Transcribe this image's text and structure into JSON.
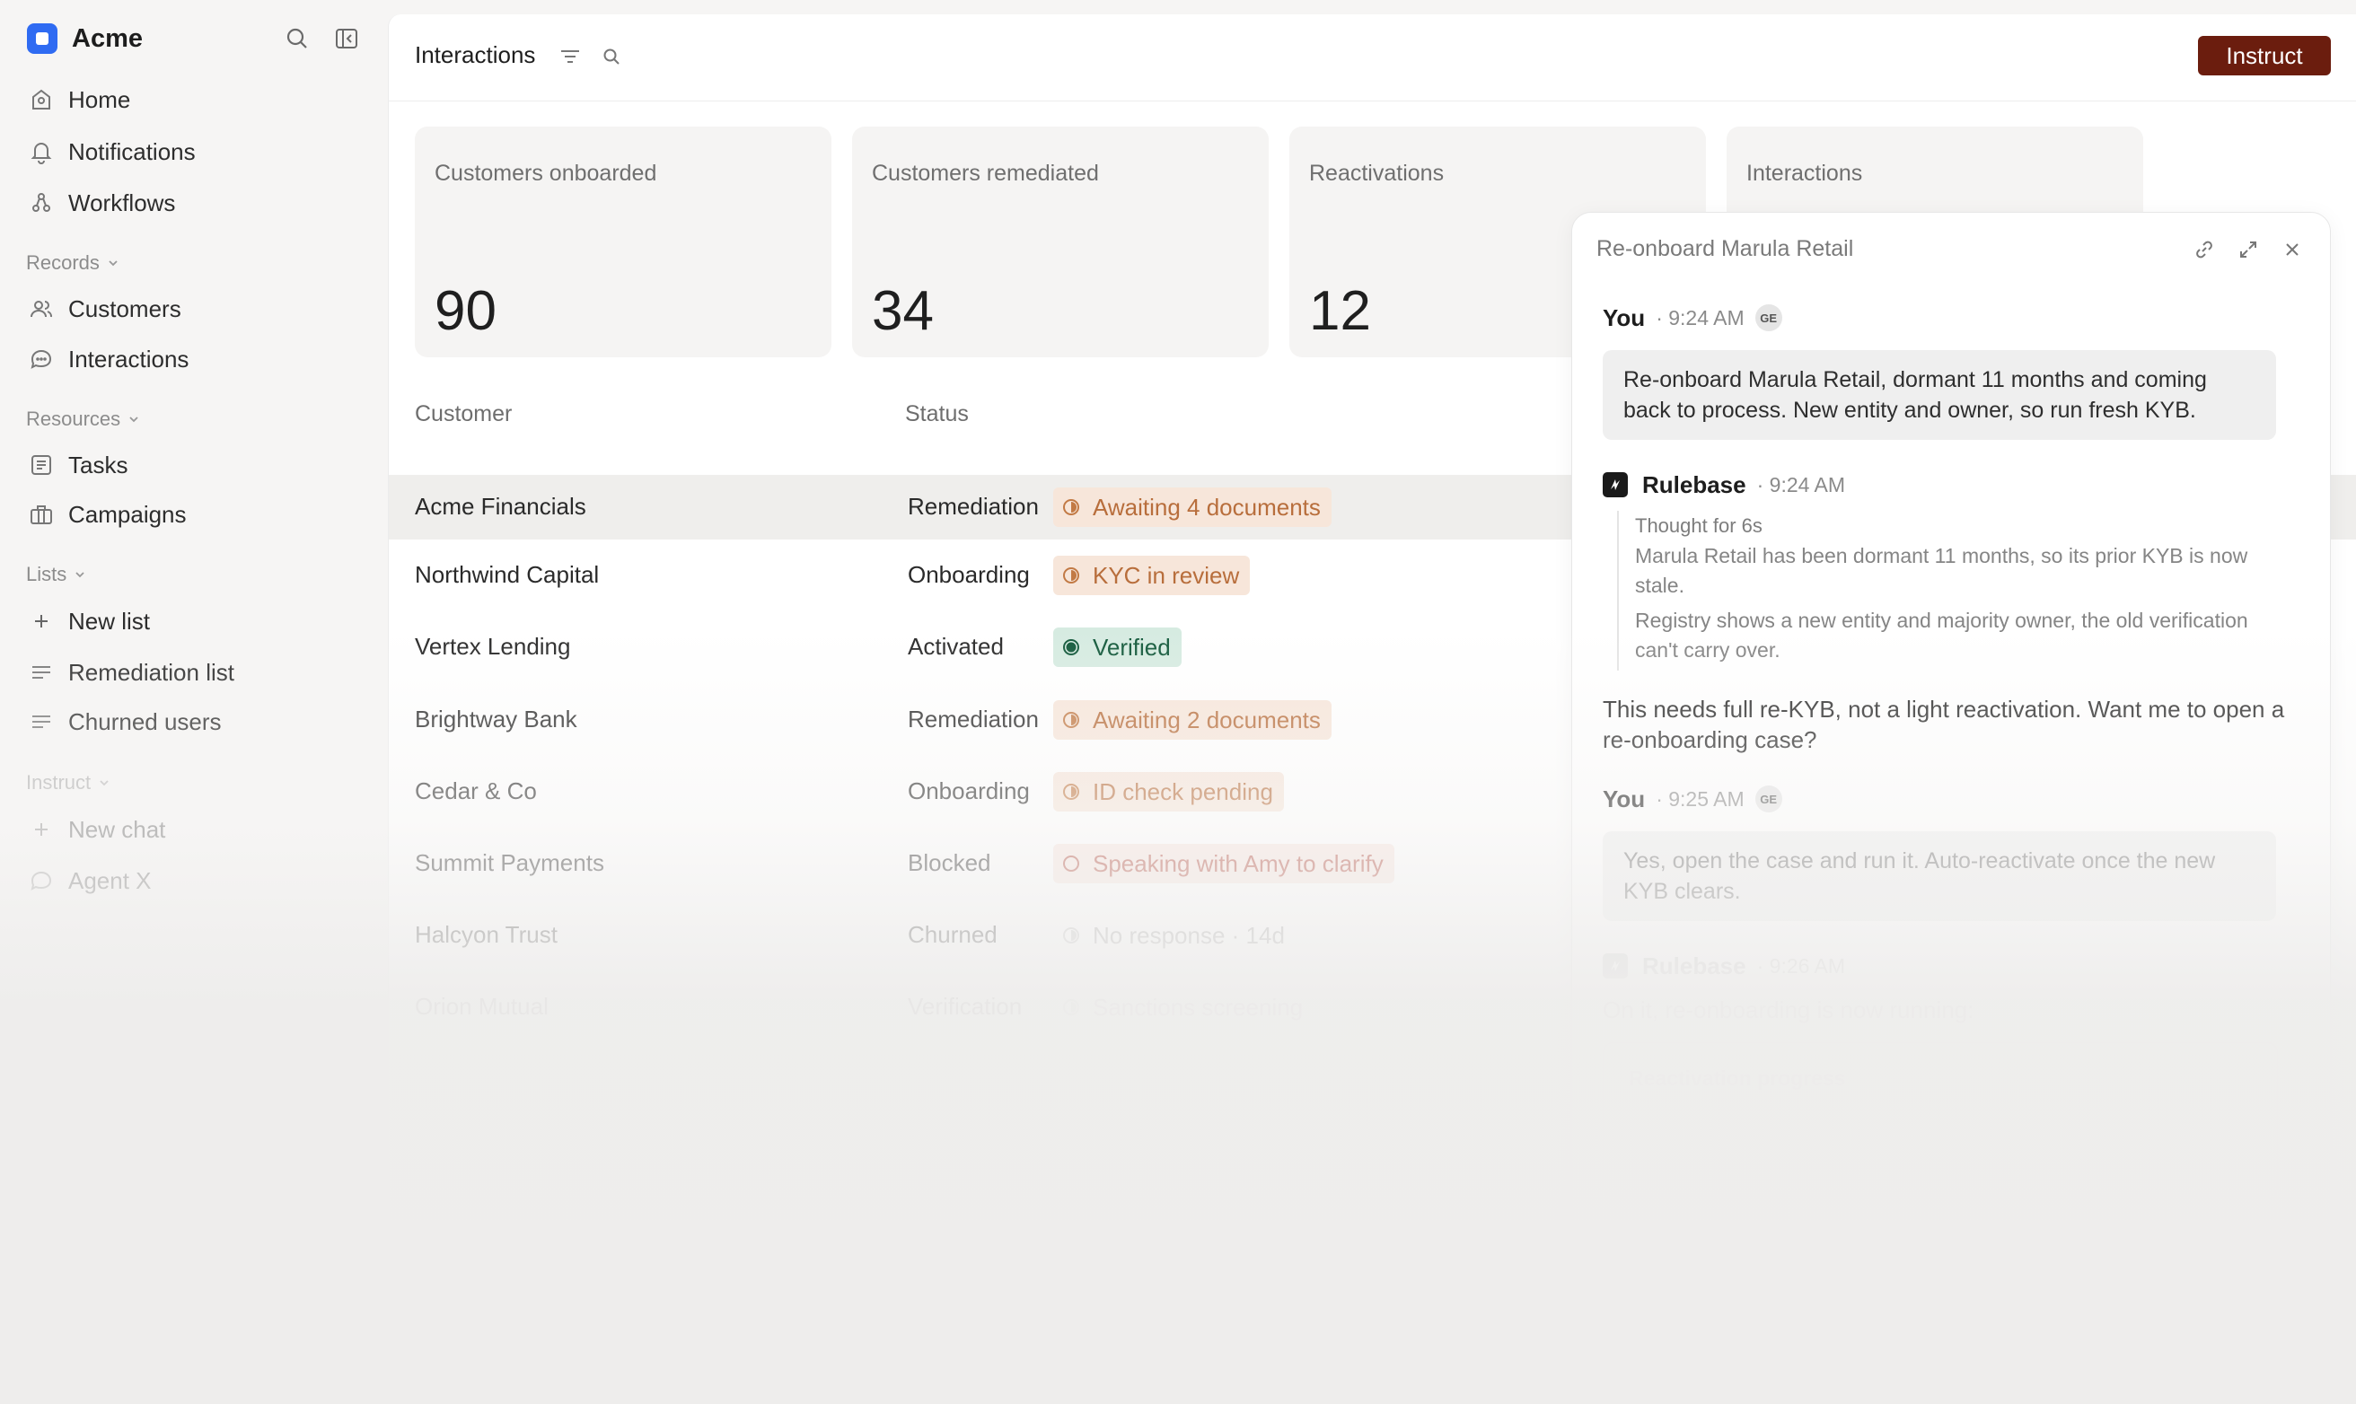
{
  "app": {
    "name": "Acme"
  },
  "sidebar": {
    "nav": [
      {
        "label": "Home",
        "icon": "home-icon"
      },
      {
        "label": "Notifications",
        "icon": "bell-icon"
      },
      {
        "label": "Workflows",
        "icon": "workflow-icon"
      }
    ],
    "records": {
      "header": "Records",
      "items": [
        {
          "label": "Customers",
          "icon": "users-icon"
        },
        {
          "label": "Interactions",
          "icon": "chat-bubble-icon"
        }
      ]
    },
    "resources": {
      "header": "Resources",
      "items": [
        {
          "label": "Tasks",
          "icon": "tasks-icon"
        },
        {
          "label": "Campaigns",
          "icon": "briefcase-icon"
        }
      ]
    },
    "lists": {
      "header": "Lists",
      "items": [
        {
          "label": "New list",
          "icon": "plus-icon"
        },
        {
          "label": "Remediation list",
          "icon": "list-icon"
        },
        {
          "label": "Churned users",
          "icon": "list-icon"
        }
      ]
    },
    "instruct": {
      "header": "Instruct",
      "items": [
        {
          "label": "New chat",
          "icon": "plus-icon"
        },
        {
          "label": "Agent X",
          "icon": "chat-bubble-icon"
        }
      ]
    }
  },
  "header": {
    "title": "Interactions",
    "instruct_label": "Instruct",
    "accent": "#6b1d0e"
  },
  "stats": [
    {
      "label": "Customers onboarded",
      "value": "90"
    },
    {
      "label": "Customers remediated",
      "value": "34"
    },
    {
      "label": "Reactivations",
      "value": "12"
    },
    {
      "label": "Interactions",
      "value": ""
    }
  ],
  "table": {
    "columns": [
      "Customer",
      "Status"
    ],
    "rows": [
      {
        "customer": "Acme Financials",
        "stage": "Remediation",
        "badge": "Awaiting 4 documents"
      },
      {
        "customer": "Northwind Capital",
        "stage": "Onboarding",
        "badge": "KYC in review"
      },
      {
        "customer": "Vertex Lending",
        "stage": "Activated",
        "badge": "Verified"
      },
      {
        "customer": "Brightway Bank",
        "stage": "Remediation",
        "badge": "Awaiting 2 documents"
      },
      {
        "customer": "Cedar & Co",
        "stage": "Onboarding",
        "badge": "ID check pending"
      },
      {
        "customer": "Summit Payments",
        "stage": "Blocked",
        "badge": "Speaking with Amy to clarify"
      },
      {
        "customer": "Halcyon Trust",
        "stage": "Churned",
        "badge": "No response · 14d"
      },
      {
        "customer": "Orion Mutual",
        "stage": "Verification",
        "badge": "Sanctions screening"
      }
    ]
  },
  "chat": {
    "title": "Re-onboard Marula Retail",
    "messages": {
      "m1": {
        "author": "You",
        "time": "· 9:24 AM",
        "avatar": "GE",
        "text": "Re-onboard Marula Retail,  dormant 11 months and coming back to process. New entity and owner, so run fresh KYB."
      },
      "m2": {
        "author": "Rulebase",
        "time": "· 9:24 AM",
        "thought_header": "Thought for 6s",
        "thoughts": [
          "Marula Retail has been dormant 11 months, so its prior KYB is now stale.",
          "Registry shows a new entity and majority owner, the old verification can't carry over."
        ],
        "text": "This needs full re-KYB, not a light reactivation. Want me to open a re-onboarding case?"
      },
      "m3": {
        "author": "You",
        "time": "· 9:25 AM",
        "avatar": "GE",
        "text": "Yes, open the case and run it. Auto-reactivate once the new KYB clears."
      },
      "m4": {
        "author": "Rulebase",
        "time": "· 9:26 AM",
        "text": "On it, re-onboarding is now running:",
        "card_title": "Reactivation progress"
      }
    }
  }
}
